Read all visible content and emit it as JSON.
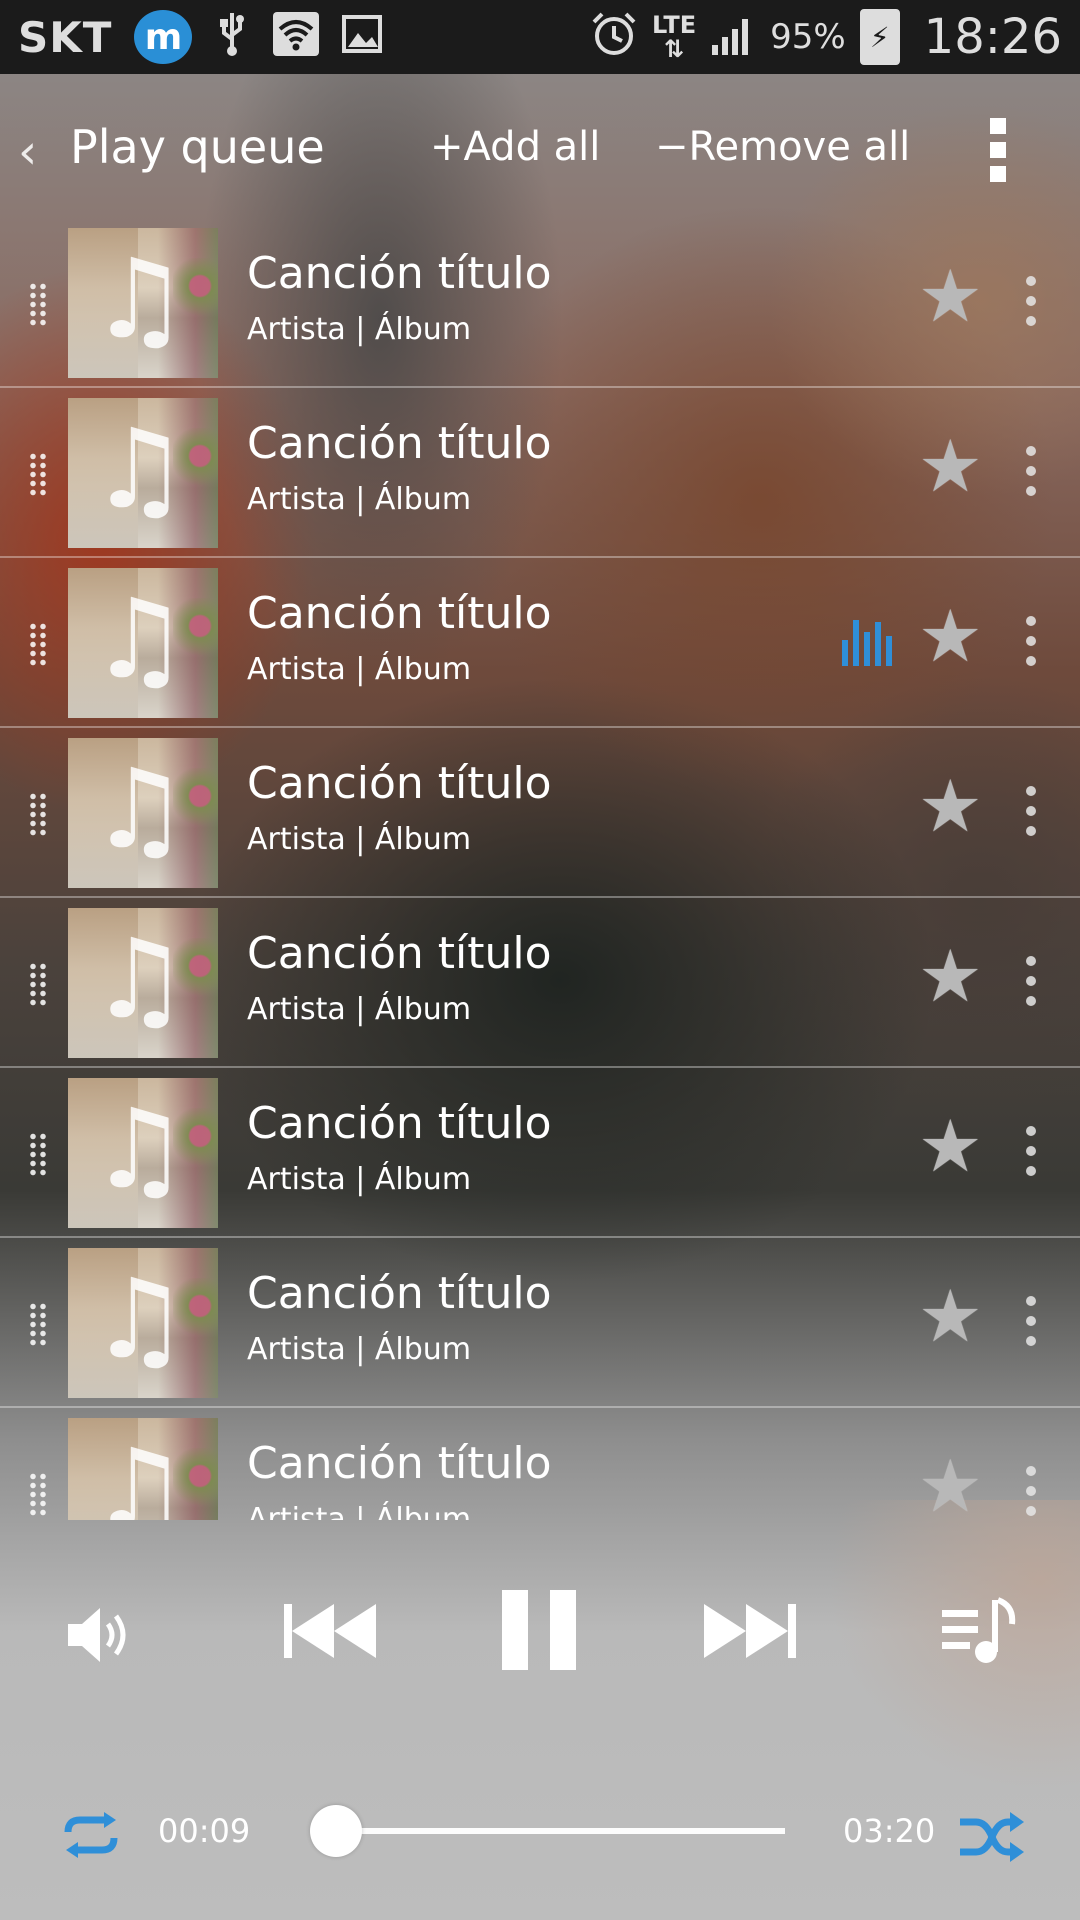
{
  "status_bar": {
    "carrier": "SKT",
    "app_badge": "m",
    "network": "LTE",
    "battery": "95%",
    "time": "18:26"
  },
  "header": {
    "title": "Play queue",
    "add_all": "+Add all",
    "remove_all": "−Remove all"
  },
  "queue": [
    {
      "title": "Canción título",
      "subtitle": "Artista | Álbum",
      "playing": false
    },
    {
      "title": "Canción título",
      "subtitle": "Artista | Álbum",
      "playing": false
    },
    {
      "title": "Canción título",
      "subtitle": "Artista | Álbum",
      "playing": true
    },
    {
      "title": "Canción título",
      "subtitle": "Artista | Álbum",
      "playing": false
    },
    {
      "title": "Canción título",
      "subtitle": "Artista | Álbum",
      "playing": false
    },
    {
      "title": "Canción título",
      "subtitle": "Artista | Álbum",
      "playing": false
    },
    {
      "title": "Canción título",
      "subtitle": "Artista | Álbum",
      "playing": false
    },
    {
      "title": "Canción título",
      "subtitle": "Artista | Álbum",
      "playing": false
    }
  ],
  "player": {
    "elapsed": "00:09",
    "total": "03:20",
    "progress": 0.045,
    "accent_color": "#2f8fd8"
  },
  "icons": {
    "controls": [
      "volume-icon",
      "previous-icon",
      "pause-icon",
      "next-icon",
      "queue-icon"
    ],
    "row": [
      "drag-handle-icon",
      "album-art",
      "equalizer-icon",
      "star-icon",
      "more-vert-icon"
    ]
  }
}
